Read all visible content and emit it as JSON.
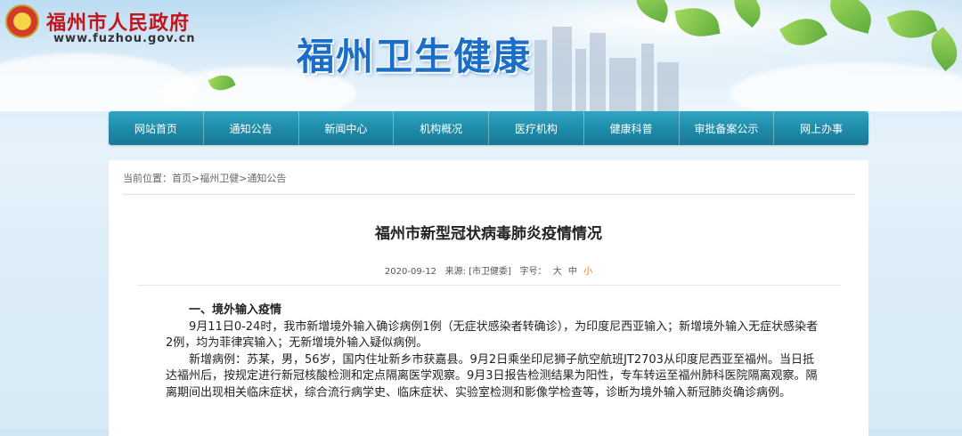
{
  "header": {
    "gov_name": "福州市人民政府",
    "gov_url": "www.fuzhou.gov.cn",
    "site_title": "福州卫生健康"
  },
  "nav": {
    "items": [
      "网站首页",
      "通知公告",
      "新闻中心",
      "机构概况",
      "医疗机构",
      "健康科普",
      "审批备案公示",
      "网上办事"
    ]
  },
  "breadcrumb": {
    "prefix": "当前位置：",
    "items": [
      "首页",
      ">",
      "福州卫健",
      ">",
      "通知公告"
    ]
  },
  "article": {
    "title": "福州市新型冠状病毒肺炎疫情情况",
    "date": "2020-09-12",
    "source_label": "来源:",
    "source": "[市卫健委]",
    "font_size_label": "字号：",
    "font_sizes": [
      "大",
      "中",
      "小"
    ],
    "section1_heading": "一、境外输入疫情",
    "para1": "9月11日0-24时，我市新增境外输入确诊病例1例（无症状感染者转确诊），为印度尼西亚输入；新增境外输入无症状感染者2例，均为菲律宾输入；无新增境外输入疑似病例。",
    "para2": "新增病例：苏某，男，56岁，国内住址新乡市获嘉县。9月2日乘坐印尼狮子航空航班JT2703从印度尼西亚至福州。当日抵达福州后，按规定进行新冠核酸检测和定点隔离医学观察。9月3日报告检测结果为阳性，专车转运至福州肺科医院隔离观察。隔离期间出现相关临床症状，综合流行病学史、临床症状、实验室检测和影像学检查等，诊断为境外输入新冠肺炎确诊病例。"
  },
  "colors": {
    "nav_bg": "#1e8aa8",
    "gov_red": "#c0161c",
    "title_blue": "#1a6ec8",
    "active_size": "#e07a1f"
  }
}
